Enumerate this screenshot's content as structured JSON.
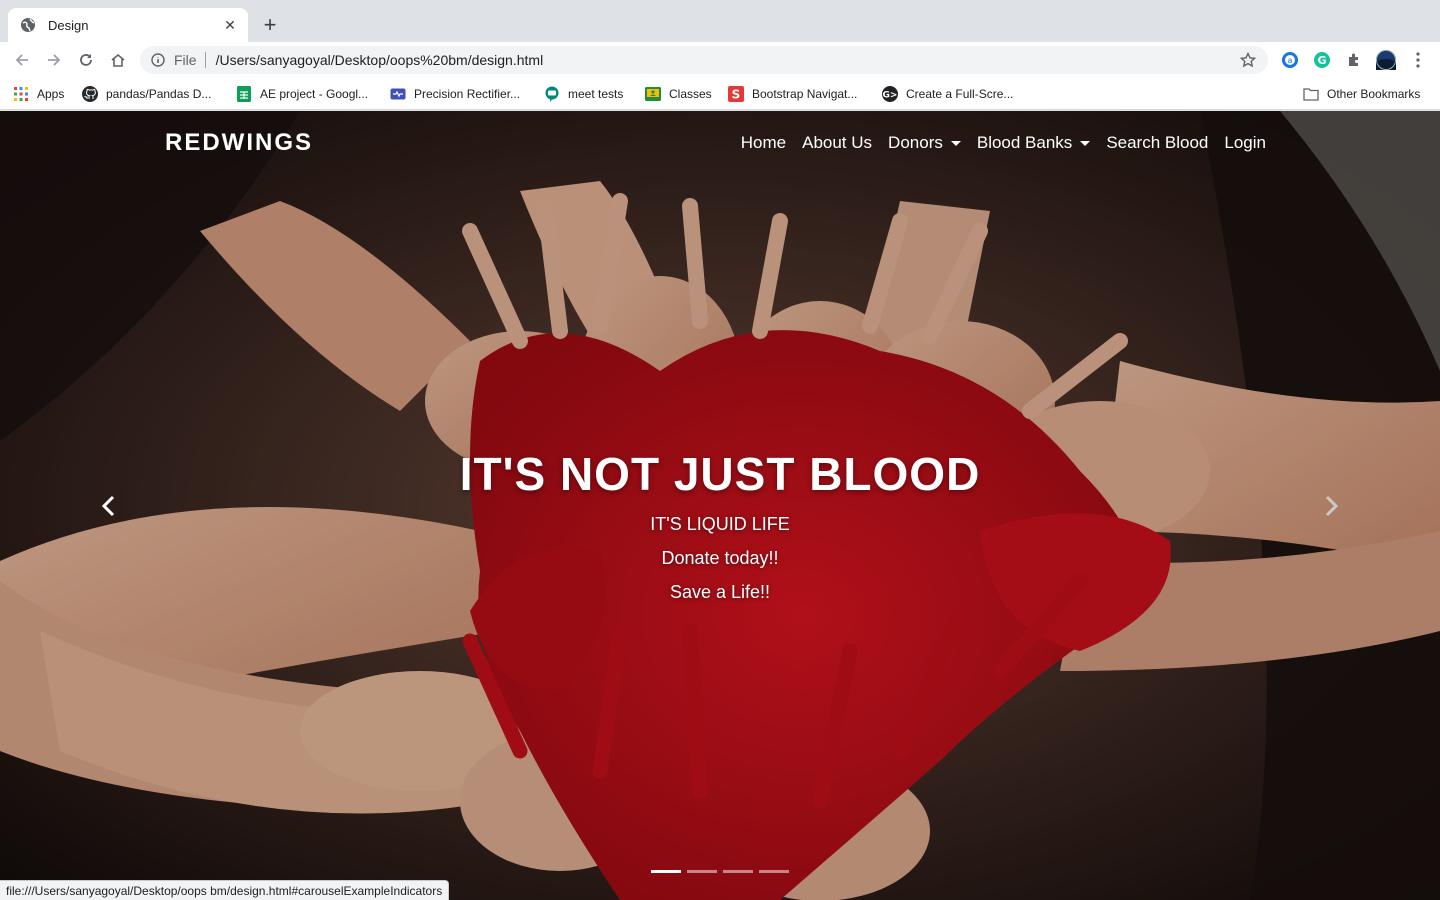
{
  "browser": {
    "tab": {
      "title": "Design",
      "favicon": "globe-icon"
    },
    "address": {
      "scheme": "File",
      "url": "/Users/sanyagoyal/Desktop/oops%20bm/design.html"
    },
    "bookmarks": [
      {
        "label": "Apps",
        "icon": "apps-grid-icon"
      },
      {
        "label": "pandas/Pandas D...",
        "icon": "github-icon"
      },
      {
        "label": "AE project - Googl...",
        "icon": "sheets-icon"
      },
      {
        "label": "Precision Rectifier...",
        "icon": "circuit-icon"
      },
      {
        "label": "meet tests",
        "icon": "meet-icon"
      },
      {
        "label": "Classes",
        "icon": "classroom-icon"
      },
      {
        "label": "Bootstrap Navigat...",
        "icon": "s-logo-icon"
      },
      {
        "label": "Create a Full-Scre...",
        "icon": "codepen-icon"
      }
    ],
    "other_bookmarks": "Other Bookmarks",
    "status_url": "file:///Users/sanyagoyal/Desktop/oops bm/design.html#carouselExampleIndicators"
  },
  "site": {
    "brand": "REDWINGS",
    "nav": {
      "home": "Home",
      "about": "About Us",
      "donors": "Donors",
      "blood_banks": "Blood Banks",
      "search": "Search Blood",
      "login": "Login"
    },
    "hero": {
      "heading": "IT'S NOT JUST BLOOD",
      "line1": "IT'S LIQUID LIFE",
      "line2": "Donate today!!",
      "line3": "Save a Life!!"
    },
    "carousel": {
      "slides": 4,
      "active": 1
    }
  },
  "colors": {
    "accent_red": "#c4101a",
    "text": "#ffffff"
  }
}
